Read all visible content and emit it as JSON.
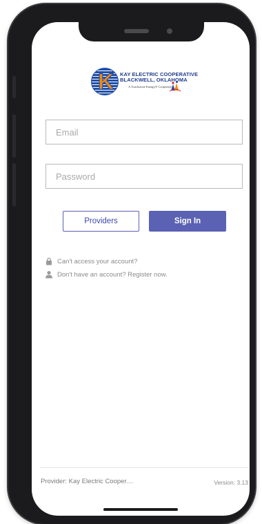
{
  "logo": {
    "line1": "KAY ELECTRIC COOPERATIVE",
    "line2": "BLACKWELL, OKLAHOMA",
    "line3": "A Touchstone Energy® Cooperative",
    "letter": "K",
    "brand_blue": "#1f4fa8",
    "brand_orange": "#f08a12"
  },
  "login": {
    "email_placeholder": "Email",
    "email_value": "",
    "password_placeholder": "Password",
    "password_value": ""
  },
  "buttons": {
    "providers_label": "Providers",
    "signin_label": "Sign In",
    "accent": "#5b61b3"
  },
  "links": {
    "cant_access": "Can't access your account?",
    "cant_access_icon": "lock-icon",
    "register": "Don't have an account? Register now.",
    "register_icon": "person-icon"
  },
  "footer": {
    "provider": "Provider: Kay Electric Cooper…",
    "version": "Version: 3.13"
  }
}
